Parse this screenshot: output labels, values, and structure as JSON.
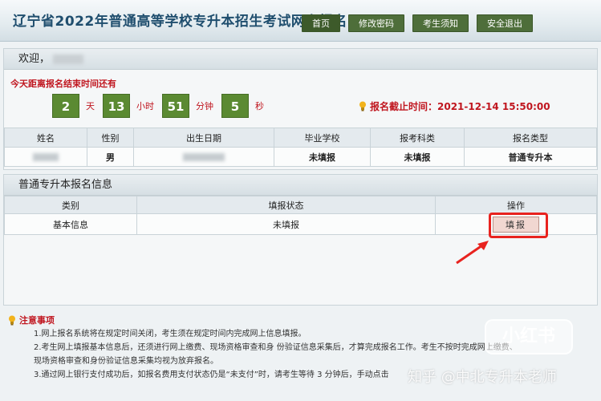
{
  "header": {
    "title": "辽宁省2022年普通高等学校专升本招生考试网上报名",
    "nav": [
      "首页",
      "修改密码",
      "考生须知",
      "安全退出"
    ]
  },
  "welcome": {
    "label": "欢迎，",
    "countdown_title": "今天距离报名结束时间还有",
    "countdown": [
      {
        "value": "2",
        "unit": "天"
      },
      {
        "value": "13",
        "unit": "小时"
      },
      {
        "value": "51",
        "unit": "分钟"
      },
      {
        "value": "5",
        "unit": "秒"
      }
    ],
    "deadline": "报名截止时间：2021-12-14 15:50:00"
  },
  "info_table": {
    "headers": [
      "姓名",
      "性别",
      "出生日期",
      "毕业学校",
      "报考科类",
      "报名类型"
    ],
    "row": {
      "gender": "男",
      "school": "未填报",
      "category": "未填报",
      "type": "普通专升本"
    }
  },
  "apply": {
    "title": "普通专升本报名信息",
    "headers": [
      "类别",
      "填报状态",
      "操作"
    ],
    "row": {
      "category": "基本信息",
      "status": "未填报",
      "action": "填报"
    }
  },
  "notes": {
    "title": "注意事项",
    "items": [
      "1.网上报名系统将在规定时间关闭，考生须在规定时间内完成网上信息填报。",
      "2.考生网上填报基本信息后，还须进行网上缴费、现场资格审查和身 份验证信息采集后，才算完成报名工作。考生不按时完成网上缴费、",
      "现场资格审查和身份验证信息采集均视为放弃报名。",
      "3.通过网上银行支付成功后，如报名费用支付状态仍是“未支付”时，请考生等待 3 分钟后，手动点击"
    ]
  },
  "watermark": {
    "box": "小红书",
    "text": "知乎 @中北专升本老师"
  },
  "colors": {
    "accent_green": "#5b8a32",
    "nav_green": "#4e6e3a",
    "alert_red": "#c0161f",
    "title_blue": "#1f4e6e"
  }
}
